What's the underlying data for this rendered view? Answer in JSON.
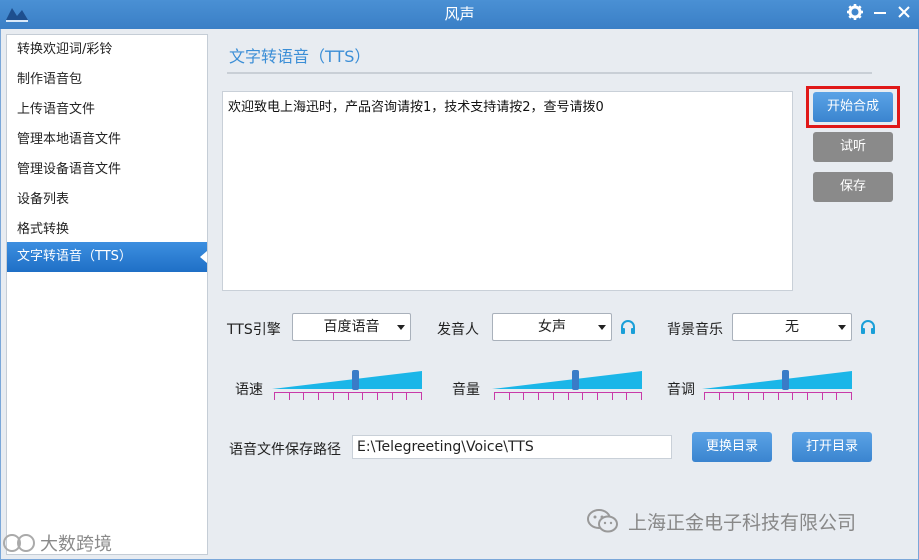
{
  "window": {
    "title": "风声",
    "logo_icon": "app-logo-icon",
    "settings_icon": "gear-icon",
    "minimize_icon": "minimize-icon",
    "close_icon": "close-icon"
  },
  "sidebar": {
    "items": [
      {
        "label": "转换欢迎词/彩铃"
      },
      {
        "label": "制作语音包"
      },
      {
        "label": "上传语音文件"
      },
      {
        "label": "管理本地语音文件"
      },
      {
        "label": "管理设备语音文件"
      },
      {
        "label": "设备列表"
      },
      {
        "label": "格式转换"
      },
      {
        "label": "文字转语音（TTS）",
        "active": true
      }
    ]
  },
  "main": {
    "section_title": "文字转语音（TTS）",
    "text_content": "欢迎致电上海迅时，产品咨询请按1，技术支持请按2，查号请拨0",
    "buttons": {
      "synthesize": "开始合成",
      "listen": "试听",
      "save": "保存"
    },
    "engine": {
      "label": "TTS引擎",
      "value": "百度语音"
    },
    "speaker": {
      "label": "发音人",
      "value": "女声"
    },
    "background_music": {
      "label": "背景音乐",
      "value": "无"
    },
    "sliders": {
      "speed": {
        "label": "语速",
        "level": 0.55
      },
      "volume": {
        "label": "音量",
        "level": 0.55
      },
      "pitch": {
        "label": "音调",
        "level": 0.55
      }
    },
    "save_path": {
      "label": "语音文件保存路径",
      "value": "E:\\Telegreeting\\Voice\\TTS"
    },
    "path_buttons": {
      "change_dir": "更换目录",
      "open_dir": "打开目录"
    }
  },
  "watermarks": {
    "company": "上海正金电子科技有限公司",
    "bottom_left": "大数跨境"
  },
  "colors": {
    "accent": "#3b8ed6",
    "title_bar": "#3f86cc",
    "highlight_box": "#e01818",
    "slider_fill": "#1bb6e8",
    "gray_button": "#8a8a8a"
  }
}
